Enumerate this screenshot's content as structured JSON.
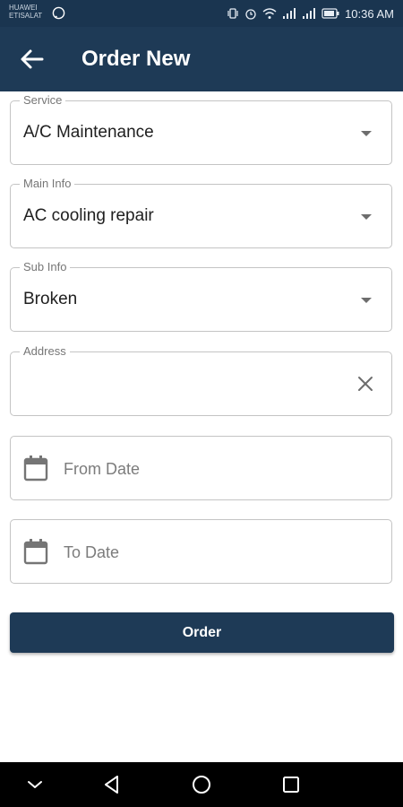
{
  "status_bar": {
    "carrier_lines": [
      "HUAWEI",
      "ETISALAT"
    ],
    "time": "10:36 AM",
    "icons": [
      "whatsapp-icon",
      "vibrate-icon",
      "alarm-icon",
      "wifi-icon",
      "signal-icon",
      "signal-icon",
      "battery-icon"
    ]
  },
  "app_bar": {
    "title": "Order New",
    "back_icon": "arrow-left-icon",
    "background": "#1e3a56"
  },
  "form": {
    "service": {
      "label": "Service",
      "value": "A/C Maintenance"
    },
    "main_info": {
      "label": "Main Info",
      "value": "AC cooling repair"
    },
    "sub_info": {
      "label": "Sub Info",
      "value": "Broken"
    },
    "address": {
      "label": "Address",
      "value": ""
    },
    "from_date": {
      "placeholder": "From Date"
    },
    "to_date": {
      "placeholder": "To Date"
    },
    "submit_label": "Order"
  },
  "nav_bar": {
    "icons": [
      "chevron-down-icon",
      "back-triangle-icon",
      "home-circle-icon",
      "recents-square-icon"
    ]
  }
}
